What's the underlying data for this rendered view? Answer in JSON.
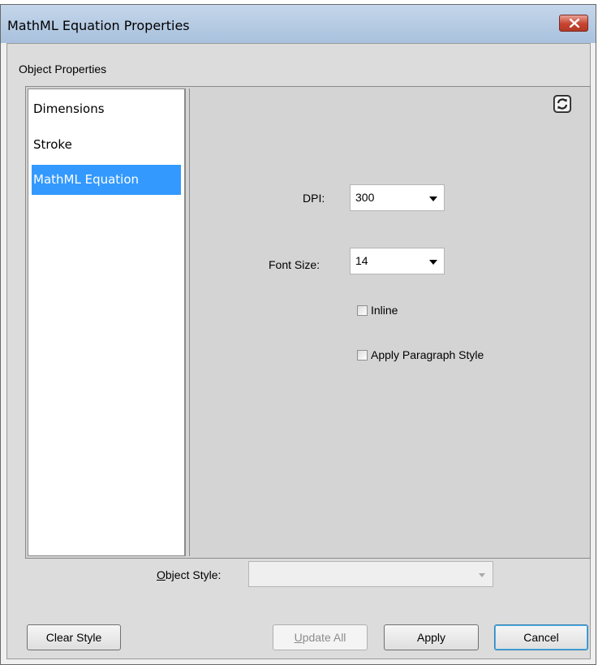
{
  "window": {
    "title": "MathML Equation Properties",
    "close_icon": "close-x-icon"
  },
  "section": {
    "label": "Object Properties"
  },
  "nav": {
    "items": [
      {
        "label": "Dimensions",
        "selected": false
      },
      {
        "label": "Stroke",
        "selected": false
      },
      {
        "label": "MathML Equation",
        "selected": true
      }
    ]
  },
  "panel": {
    "refresh_icon": "refresh-icon",
    "dpi": {
      "label": "DPI:",
      "value": "300"
    },
    "font_size": {
      "label": "Font Size:",
      "value": "14"
    },
    "inline": {
      "label": "Inline",
      "checked": false
    },
    "apply_paragraph_style": {
      "label": "Apply Paragraph Style",
      "checked": false
    }
  },
  "object_style": {
    "label_prefix": "",
    "label_access_key": "O",
    "label_rest": "bject Style:",
    "value": ""
  },
  "buttons": {
    "clear_style": "Clear Style",
    "update_all_key": "U",
    "update_all_rest": "pdate All",
    "apply": "Apply",
    "cancel": "Cancel"
  },
  "colors": {
    "selection": "#3399ff",
    "titlebar": "#b9cfe7",
    "close_button": "#c7432f"
  }
}
